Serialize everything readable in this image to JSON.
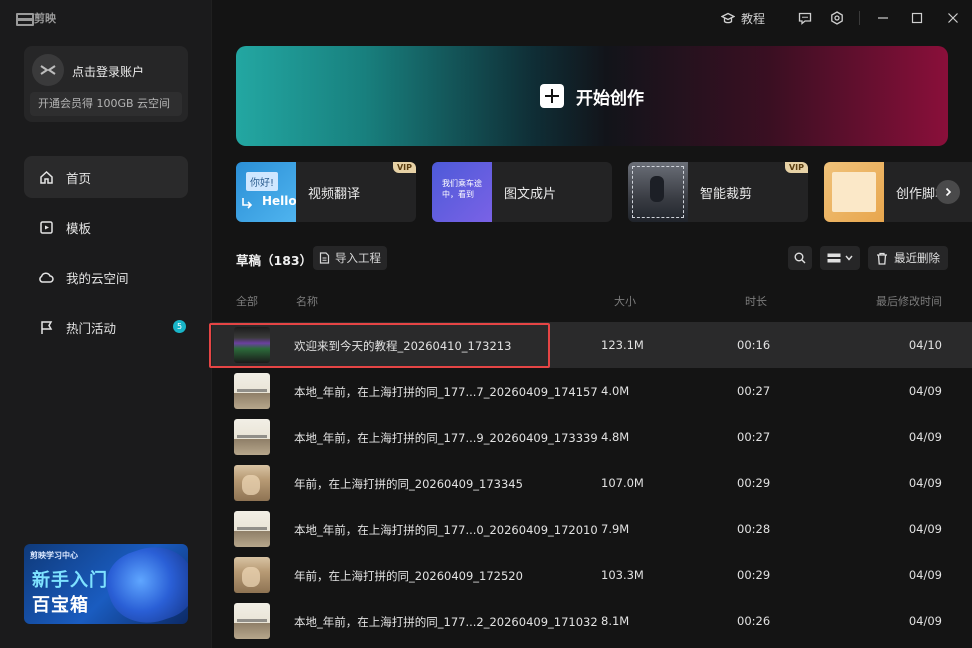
{
  "app": {
    "logo_text": "剪映"
  },
  "account": {
    "login": "点击登录账户",
    "vip_promo": "开通会员得 100GB 云空间"
  },
  "nav": [
    {
      "label": "首页",
      "icon": "home-icon",
      "active": true
    },
    {
      "label": "模板",
      "icon": "template-icon"
    },
    {
      "label": "我的云空间",
      "icon": "cloud-icon"
    },
    {
      "label": "热门活动",
      "icon": "flag-icon",
      "badge": "5"
    }
  ],
  "promo": {
    "small": "剪映学习中心",
    "line1": "新手入门",
    "line2": "百宝箱"
  },
  "titlebar": {
    "tutorial": "教程"
  },
  "hero": {
    "label": "开始创作"
  },
  "tools": [
    {
      "label": "视频翻译",
      "vip": "VIP",
      "thumb_text1": "你好!",
      "thumb_text2": "Hello"
    },
    {
      "label": "图文成片",
      "thumb_text": "我们乘车途中，看到"
    },
    {
      "label": "智能裁剪",
      "vip": "VIP"
    },
    {
      "label": "创作脚本"
    }
  ],
  "drafts": {
    "title": "草稿（183）",
    "import_label": "导入工程",
    "recent_delete_label": "最近删除",
    "columns": {
      "all": "全部",
      "name": "名称",
      "size": "大小",
      "duration": "时长",
      "modified": "最后修改时间"
    },
    "rows": [
      {
        "name": "欢迎来到今天的教程_20260410_173213",
        "size": "123.1M",
        "duration": "00:16",
        "date": "04/10",
        "thumb": "a"
      },
      {
        "name": "本地_年前，在上海打拼的同_177...7_20260409_174157",
        "size": "4.0M",
        "duration": "00:27",
        "date": "04/09",
        "thumb": "b"
      },
      {
        "name": "本地_年前，在上海打拼的同_177...9_20260409_173339",
        "size": "4.8M",
        "duration": "00:27",
        "date": "04/09",
        "thumb": "b"
      },
      {
        "name": "年前，在上海打拼的同_20260409_173345",
        "size": "107.0M",
        "duration": "00:29",
        "date": "04/09",
        "thumb": "c"
      },
      {
        "name": "本地_年前，在上海打拼的同_177...0_20260409_172010",
        "size": "7.9M",
        "duration": "00:28",
        "date": "04/09",
        "thumb": "b"
      },
      {
        "name": "年前，在上海打拼的同_20260409_172520",
        "size": "103.3M",
        "duration": "00:29",
        "date": "04/09",
        "thumb": "c"
      },
      {
        "name": "本地_年前，在上海打拼的同_177...2_20260409_171032",
        "size": "8.1M",
        "duration": "00:26",
        "date": "04/09",
        "thumb": "b"
      }
    ]
  },
  "colors": {
    "accent_badge": "#19b5c8",
    "highlight_box": "#e54545",
    "background": "#141414"
  }
}
